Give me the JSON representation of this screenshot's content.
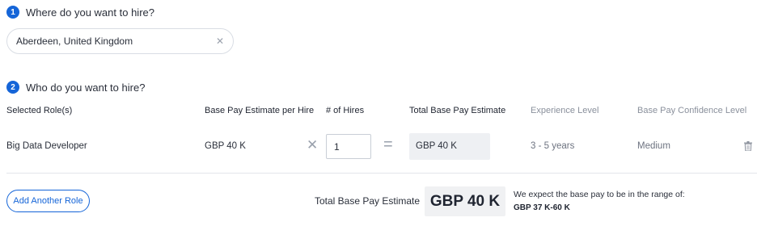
{
  "step1": {
    "number": "1",
    "question": "Where do you want to hire?"
  },
  "location": {
    "value": "Aberdeen, United Kingdom",
    "clear_glyph": "✕"
  },
  "step2": {
    "number": "2",
    "question": "Who do you want to hire?"
  },
  "table": {
    "headers": {
      "role": "Selected Role(s)",
      "base_pay": "Base Pay Estimate per Hire",
      "hires": "# of Hires",
      "total": "Total Base Pay Estimate",
      "experience": "Experience Level",
      "confidence": "Base Pay Confidence Level"
    },
    "rows": [
      {
        "role": "Big Data Developer",
        "base_pay": "GBP 40 K",
        "times_glyph": "✕",
        "hires": "1",
        "equals_glyph": "=",
        "total": "GBP 40 K",
        "experience": "3 - 5 years",
        "confidence": "Medium",
        "delete_icon": "trash-icon"
      }
    ]
  },
  "footer": {
    "add_role_label": "Add Another Role",
    "total_label": "Total Base Pay Estimate",
    "total_value": "GBP 40 K",
    "range_note": "We expect the base pay to be in the range of:",
    "range_value": "GBP 37 K-60 K"
  },
  "colors": {
    "accent": "#1565d8",
    "muted": "#8a909c",
    "box_bg": "#eef0f3"
  }
}
